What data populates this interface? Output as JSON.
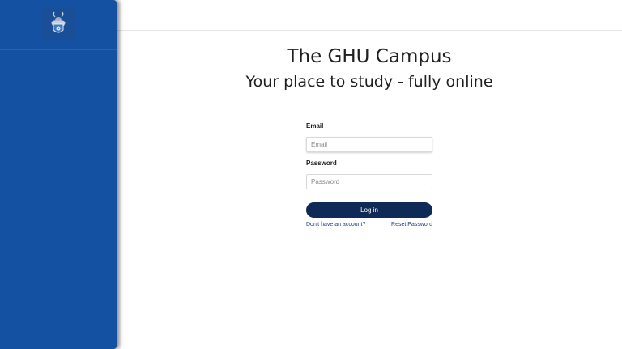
{
  "brand": {
    "primary_color": "#1551a3",
    "button_color": "#0f2a57",
    "logo_icon": "coat-of-arms-icon"
  },
  "hero": {
    "title": "The GHU Campus",
    "subtitle": "Your place to study - fully online"
  },
  "form": {
    "email_label": "Email",
    "email_placeholder": "Email",
    "email_value": "",
    "password_label": "Password",
    "password_placeholder": "Password",
    "password_value": "",
    "login_label": "Log in",
    "signup_link": "Don't have an account?",
    "reset_link": "Reset Password"
  }
}
